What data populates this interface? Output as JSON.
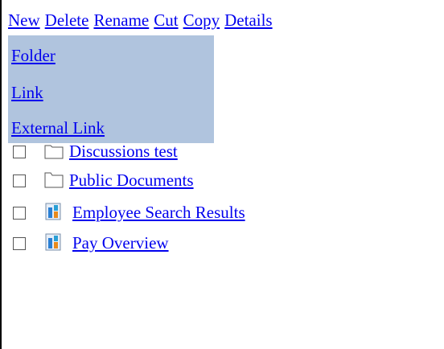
{
  "toolbar": {
    "new_label": "New",
    "delete_label": "Delete",
    "rename_label": "Rename",
    "cut_label": "Cut",
    "copy_label": "Copy",
    "details_label": "Details"
  },
  "new_menu": {
    "items": [
      {
        "label": "Folder"
      },
      {
        "label": "Link"
      },
      {
        "label": "External Link"
      }
    ],
    "background_color": "#b0c4de"
  },
  "items": [
    {
      "label": "Discussions test",
      "icon": "folder-icon"
    },
    {
      "label": "Public Documents",
      "icon": "folder-icon"
    },
    {
      "label": "Employee Search Results",
      "icon": "report-icon"
    },
    {
      "label": "Pay Overview",
      "icon": "report-icon"
    }
  ],
  "colors": {
    "link": "#0000ee"
  }
}
